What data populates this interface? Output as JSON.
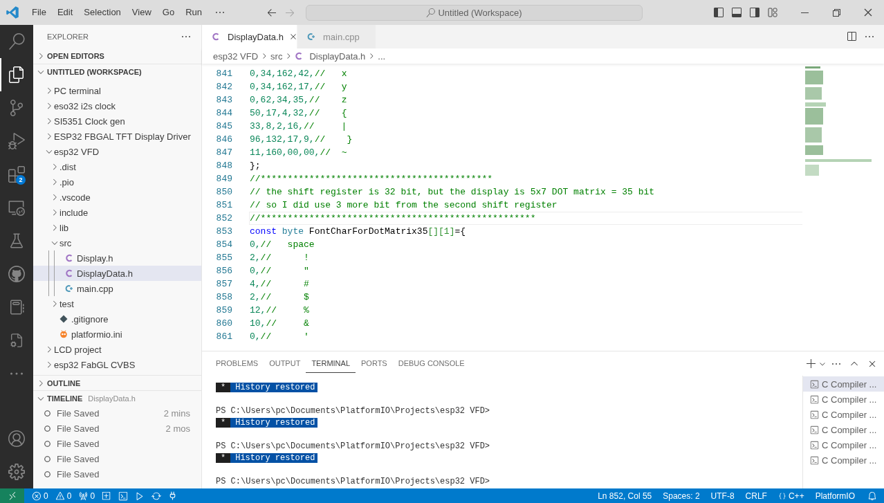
{
  "menu": [
    {
      "label": "File"
    },
    {
      "label": "Edit"
    },
    {
      "label": "Selection"
    },
    {
      "label": "View"
    },
    {
      "label": "Go"
    },
    {
      "label": "Run"
    }
  ],
  "command_center": {
    "text": "Untitled (Workspace)"
  },
  "activity_bar": {
    "items": [
      {
        "kind": "search",
        "selected": false
      },
      {
        "kind": "explorer",
        "selected": true
      },
      {
        "kind": "scm",
        "selected": false
      },
      {
        "kind": "debug",
        "selected": false
      },
      {
        "kind": "extensions",
        "selected": false,
        "badge": "2"
      },
      {
        "kind": "remote",
        "selected": false
      },
      {
        "kind": "testing",
        "selected": false
      },
      {
        "kind": "github",
        "selected": false
      },
      {
        "kind": "notebook",
        "selected": false
      },
      {
        "kind": "cppconfig",
        "selected": false
      },
      {
        "kind": "more",
        "selected": false
      }
    ],
    "bottom": [
      {
        "kind": "account"
      },
      {
        "kind": "settings"
      }
    ]
  },
  "sidebar": {
    "title": "EXPLORER",
    "sections": [
      {
        "label": "OPEN EDITORS",
        "expanded": false
      },
      {
        "label": "UNTITLED (WORKSPACE)",
        "expanded": true
      }
    ],
    "tree": [
      {
        "label": "PC terminal",
        "kind": "folder",
        "expanded": false,
        "selected": false
      },
      {
        "label": "eso32 i2s clock",
        "kind": "folder",
        "expanded": false,
        "selected": false
      },
      {
        "label": "SI5351 Clock gen",
        "kind": "folder",
        "expanded": false,
        "selected": false
      },
      {
        "label": "ESP32 FBGAL TFT Display Driver",
        "kind": "folder",
        "expanded": false,
        "selected": false
      },
      {
        "label": "esp32 VFD",
        "kind": "folder",
        "expanded": true,
        "selected": false,
        "children": [
          {
            "label": ".dist",
            "kind": "folder",
            "expanded": false,
            "selected": false
          },
          {
            "label": ".pio",
            "kind": "folder",
            "expanded": false,
            "selected": false
          },
          {
            "label": ".vscode",
            "kind": "folder",
            "expanded": false,
            "selected": false
          },
          {
            "label": "include",
            "kind": "folder",
            "expanded": false,
            "selected": false
          },
          {
            "label": "lib",
            "kind": "folder",
            "expanded": false,
            "selected": false
          },
          {
            "label": "src",
            "kind": "folder",
            "expanded": true,
            "selected": false,
            "children": [
              {
                "label": "Display.h",
                "kind": "c",
                "selected": false
              },
              {
                "label": "DisplayData.h",
                "kind": "c",
                "selected": true
              },
              {
                "label": "main.cpp",
                "kind": "cpp",
                "selected": false
              }
            ]
          },
          {
            "label": "test",
            "kind": "folder",
            "expanded": false,
            "selected": false
          },
          {
            "label": ".gitignore",
            "kind": "git",
            "selected": false
          },
          {
            "label": "platformio.ini",
            "kind": "pio",
            "selected": false
          }
        ]
      },
      {
        "label": "LCD project",
        "kind": "folder",
        "expanded": false,
        "selected": false
      },
      {
        "label": "esp32 FabGL CVBS",
        "kind": "folder",
        "expanded": false,
        "selected": false
      }
    ],
    "outline": {
      "label": "OUTLINE",
      "expanded": false
    },
    "timeline": {
      "label": "TIMELINE",
      "file": "DisplayData.h",
      "expanded": true,
      "items": [
        {
          "label": "File Saved",
          "time": "2 mins"
        },
        {
          "label": "File Saved",
          "time": "2 mos"
        },
        {
          "label": "File Saved"
        },
        {
          "label": "File Saved"
        },
        {
          "label": "File Saved"
        }
      ]
    }
  },
  "tabs": [
    {
      "label": "DisplayData.h",
      "kind": "c",
      "selected": true
    },
    {
      "label": "main.cpp",
      "kind": "cpp",
      "selected": false
    }
  ],
  "breadcrumb": [
    {
      "label": "esp32 VFD"
    },
    {
      "label": "src"
    },
    {
      "label": "DisplayData.h",
      "kind": "c"
    },
    {
      "label": "..."
    }
  ],
  "code": [
    {
      "number": "841",
      "current": false,
      "tokens": [
        {
          "kind": "number",
          "text": "0,34,162,42,"
        },
        {
          "kind": "comment",
          "text": "//   x"
        }
      ]
    },
    {
      "number": "842",
      "current": false,
      "tokens": [
        {
          "kind": "number",
          "text": "0,34,162,17,"
        },
        {
          "kind": "comment",
          "text": "//   y"
        }
      ]
    },
    {
      "number": "843",
      "current": false,
      "tokens": [
        {
          "kind": "number",
          "text": "0,62,34,35,"
        },
        {
          "kind": "comment",
          "text": "//    z"
        }
      ]
    },
    {
      "number": "844",
      "current": false,
      "tokens": [
        {
          "kind": "number",
          "text": "50,17,4,32,"
        },
        {
          "kind": "comment",
          "text": "//    {"
        }
      ]
    },
    {
      "number": "845",
      "current": false,
      "tokens": [
        {
          "kind": "number",
          "text": "33,8,2,16,"
        },
        {
          "kind": "comment",
          "text": "//     |"
        }
      ]
    },
    {
      "number": "846",
      "current": false,
      "tokens": [
        {
          "kind": "number",
          "text": "96,132,17,9,"
        },
        {
          "kind": "comment",
          "text": "//    }"
        }
      ]
    },
    {
      "number": "847",
      "current": false,
      "tokens": [
        {
          "kind": "number",
          "text": "11,160,00,00,"
        },
        {
          "kind": "comment",
          "text": "//  ~"
        }
      ]
    },
    {
      "number": "848",
      "current": false,
      "tokens": [
        {
          "kind": "plain",
          "text": "};"
        }
      ]
    },
    {
      "number": "849",
      "current": false,
      "tokens": [
        {
          "kind": "comment",
          "text": "//*******************************************"
        }
      ]
    },
    {
      "number": "850",
      "current": false,
      "tokens": [
        {
          "kind": "comment",
          "text": "// the shift register is 32 bit, but the display is 5x7 DOT matrix = 35 bit"
        }
      ]
    },
    {
      "number": "851",
      "current": false,
      "tokens": [
        {
          "kind": "comment",
          "text": "// so I did use 3 more bit from the second shift register"
        }
      ]
    },
    {
      "number": "852",
      "current": true,
      "tokens": [
        {
          "kind": "comment",
          "text": "//***************************************************"
        }
      ]
    },
    {
      "number": "853",
      "current": false,
      "tokens": [
        {
          "kind": "keyword",
          "text": "const"
        },
        {
          "kind": "type",
          "text": " byte"
        },
        {
          "kind": "plain",
          "text": " FontCharForDotMatrix35"
        },
        {
          "kind": "bracket",
          "text": "[][1]"
        },
        {
          "kind": "plain",
          "text": "={"
        }
      ]
    },
    {
      "number": "854",
      "current": false,
      "tokens": [
        {
          "kind": "number",
          "text": "0,"
        },
        {
          "kind": "comment",
          "text": "//   space"
        }
      ]
    },
    {
      "number": "855",
      "current": false,
      "tokens": [
        {
          "kind": "number",
          "text": "2,"
        },
        {
          "kind": "comment",
          "text": "//      !"
        }
      ]
    },
    {
      "number": "856",
      "current": false,
      "tokens": [
        {
          "kind": "number",
          "text": "0,"
        },
        {
          "kind": "comment",
          "text": "//      \""
        }
      ]
    },
    {
      "number": "857",
      "current": false,
      "tokens": [
        {
          "kind": "number",
          "text": "4,"
        },
        {
          "kind": "comment",
          "text": "//      #"
        }
      ]
    },
    {
      "number": "858",
      "current": false,
      "tokens": [
        {
          "kind": "number",
          "text": "2,"
        },
        {
          "kind": "comment",
          "text": "//      $"
        }
      ]
    },
    {
      "number": "859",
      "current": false,
      "tokens": [
        {
          "kind": "number",
          "text": "12,"
        },
        {
          "kind": "comment",
          "text": "//     %"
        }
      ]
    },
    {
      "number": "860",
      "current": false,
      "tokens": [
        {
          "kind": "number",
          "text": "10,"
        },
        {
          "kind": "comment",
          "text": "//     &"
        }
      ]
    },
    {
      "number": "861",
      "current": false,
      "tokens": [
        {
          "kind": "number",
          "text": "0,"
        },
        {
          "kind": "comment",
          "text": "//      '"
        }
      ]
    }
  ],
  "panel": {
    "tabs": [
      {
        "label": "PROBLEMS",
        "selected": false
      },
      {
        "label": "OUTPUT",
        "selected": false
      },
      {
        "label": "TERMINAL",
        "selected": true
      },
      {
        "label": "PORTS",
        "selected": false
      },
      {
        "label": "DEBUG CONSOLE",
        "selected": false
      }
    ],
    "terminal": [
      {
        "kind": "banner",
        "marker": "*",
        "text": "History restored"
      },
      {
        "kind": "blank"
      },
      {
        "kind": "prompt",
        "text": "PS C:\\Users\\pc\\Documents\\PlatformIO\\Projects\\esp32 VFD>"
      },
      {
        "kind": "banner",
        "marker": "*",
        "text": "History restored"
      },
      {
        "kind": "blank"
      },
      {
        "kind": "prompt",
        "text": "PS C:\\Users\\pc\\Documents\\PlatformIO\\Projects\\esp32 VFD>"
      },
      {
        "kind": "banner",
        "marker": "*",
        "text": "History restored"
      },
      {
        "kind": "blank"
      },
      {
        "kind": "prompt",
        "text": "PS C:\\Users\\pc\\Documents\\PlatformIO\\Projects\\esp32 VFD>"
      }
    ],
    "sessions": [
      {
        "label": "C Compiler ...",
        "selected": true
      },
      {
        "label": "C Compiler ...",
        "selected": false
      },
      {
        "label": "C Compiler ...",
        "selected": false
      },
      {
        "label": "C Compiler ...",
        "selected": false
      },
      {
        "label": "C Compiler ...",
        "selected": false
      },
      {
        "label": "C Compiler ...",
        "selected": false
      }
    ]
  },
  "status_bar": {
    "left": [
      {
        "kind": "errors",
        "text": "0"
      },
      {
        "kind": "warnings",
        "text": "0"
      },
      {
        "kind": "ports",
        "text": "0"
      },
      {
        "kind": "new"
      },
      {
        "kind": "terminal"
      },
      {
        "kind": "play"
      },
      {
        "kind": "sync"
      },
      {
        "kind": "plug"
      }
    ],
    "right": [
      {
        "kind": "text",
        "text": "Ln 852, Col 55"
      },
      {
        "kind": "text",
        "text": "Spaces: 2"
      },
      {
        "kind": "text",
        "text": "UTF-8"
      },
      {
        "kind": "text",
        "text": "CRLF"
      },
      {
        "kind": "language",
        "text": "C++"
      },
      {
        "kind": "text",
        "text": "PlatformIO"
      },
      {
        "kind": "bell"
      }
    ]
  }
}
